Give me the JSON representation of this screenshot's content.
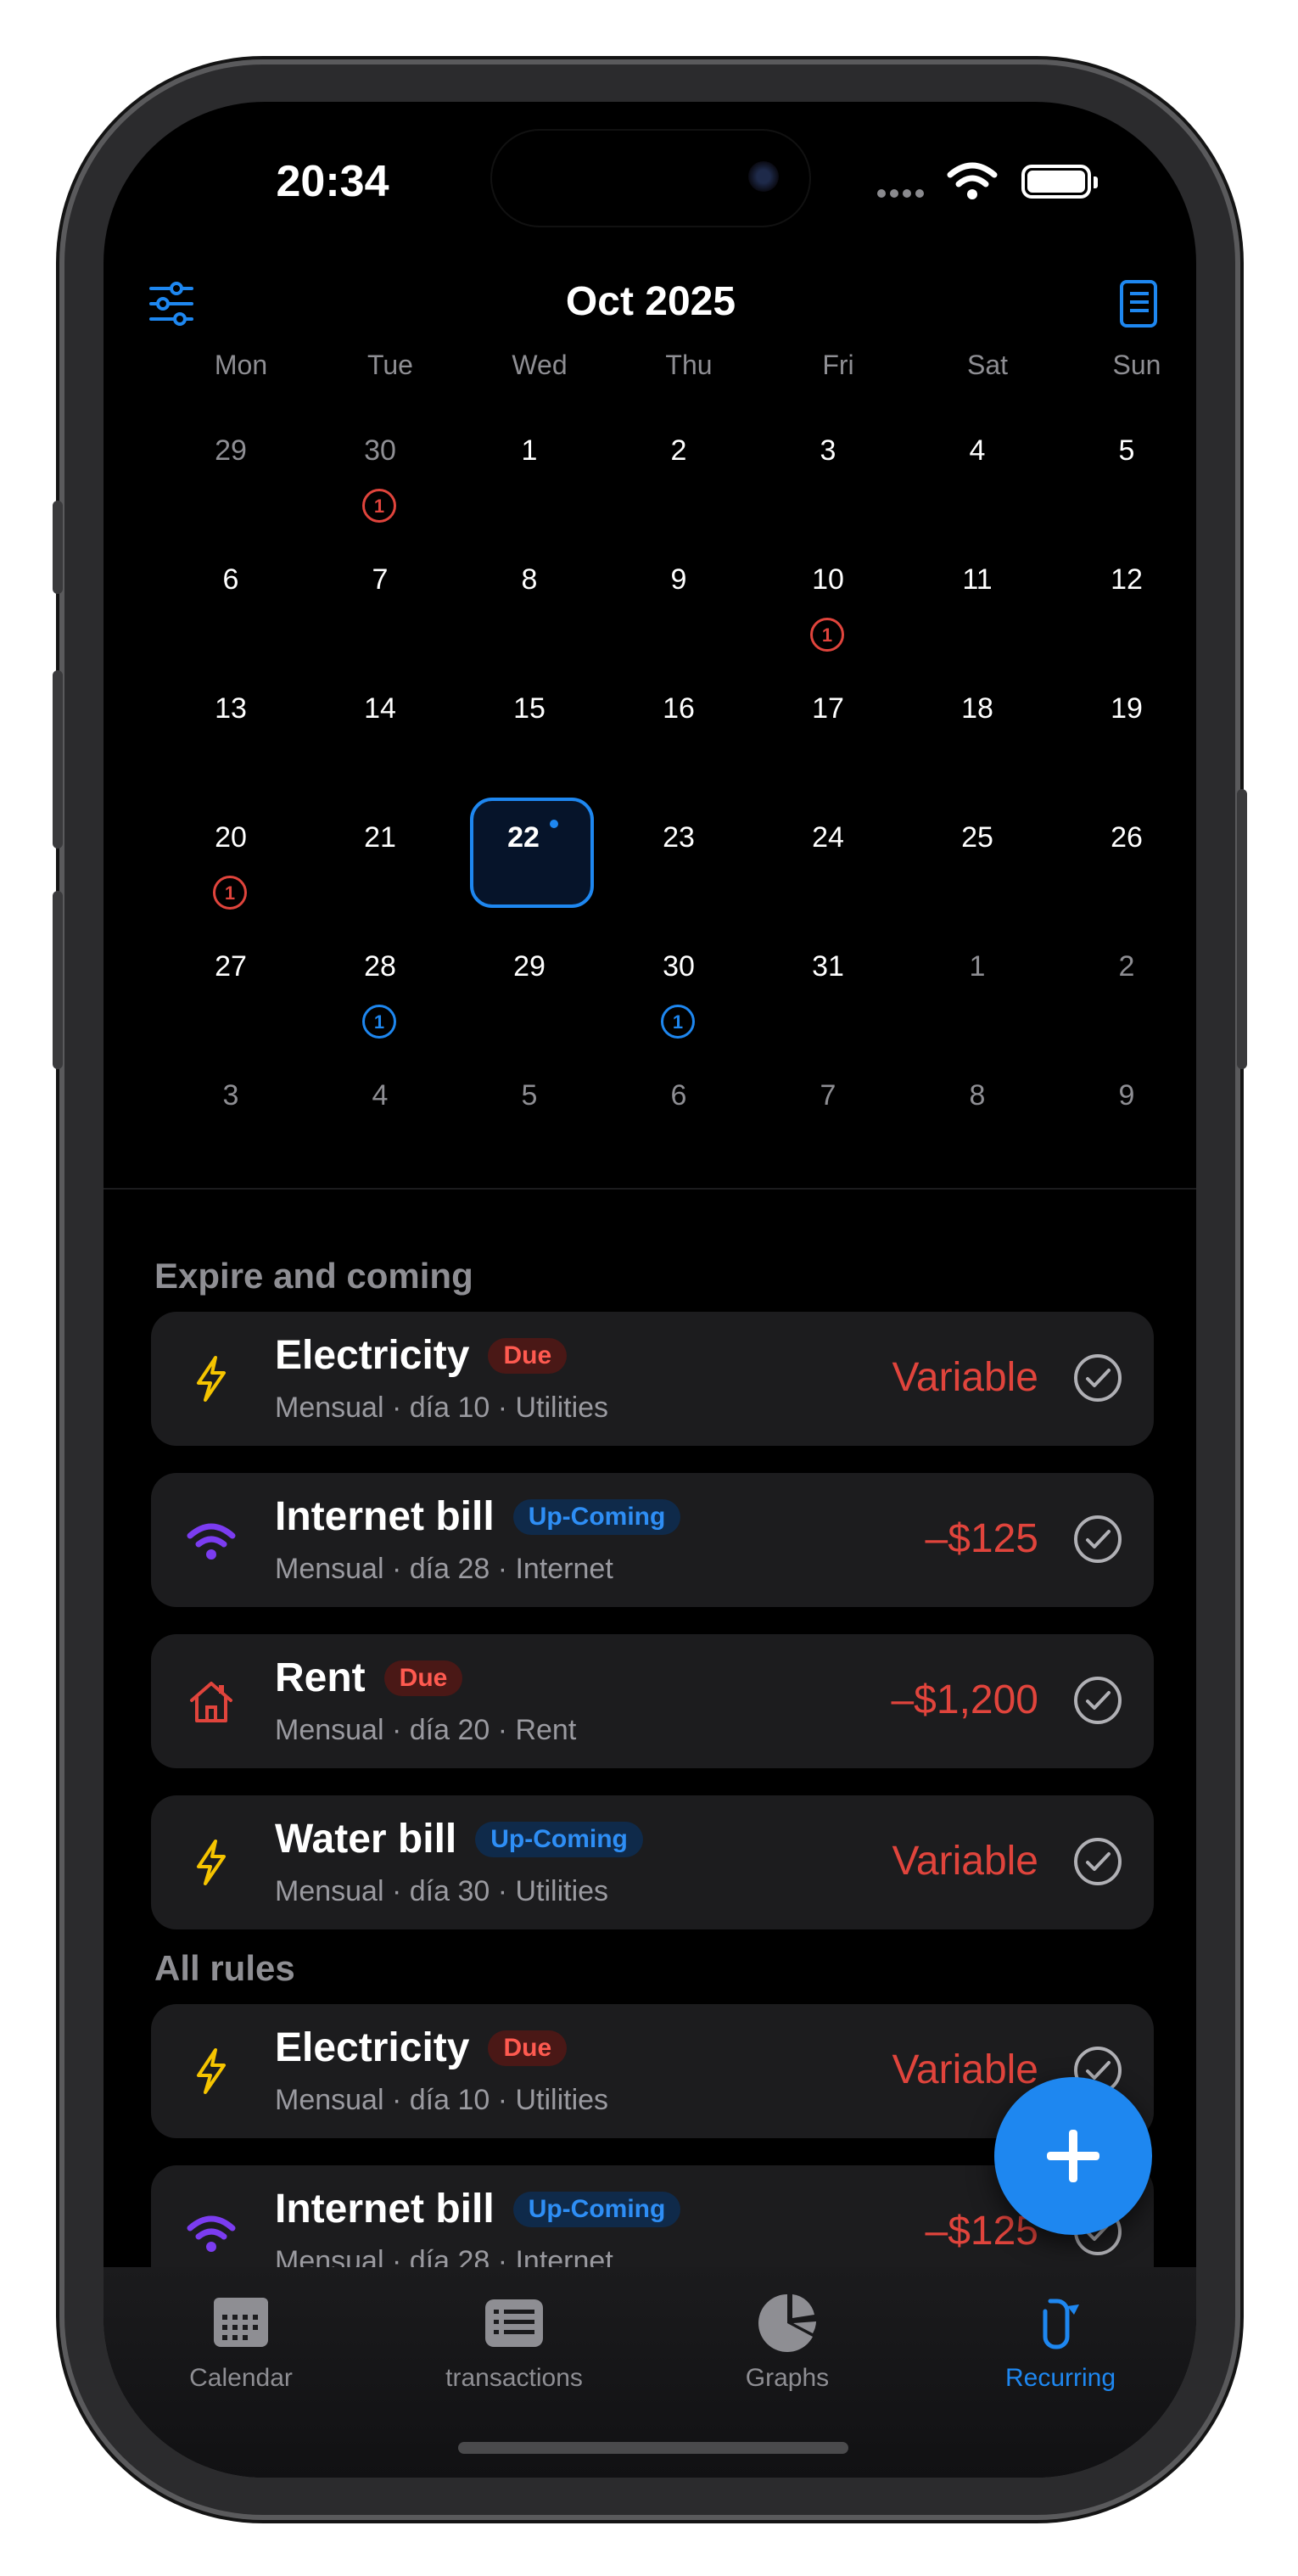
{
  "status": {
    "time": "20:34"
  },
  "header": {
    "title": "Oct 2025"
  },
  "calendar": {
    "weekdays": [
      "Mon",
      "Tue",
      "Wed",
      "Thu",
      "Fri",
      "Sat",
      "Sun"
    ],
    "weeks": [
      [
        "29",
        "30",
        "1",
        "2",
        "3",
        "4",
        "5"
      ],
      [
        "6",
        "7",
        "8",
        "9",
        "10",
        "11",
        "12"
      ],
      [
        "13",
        "14",
        "15",
        "16",
        "17",
        "18",
        "19"
      ],
      [
        "20",
        "21",
        "22",
        "23",
        "24",
        "25",
        "26"
      ],
      [
        "27",
        "28",
        "29",
        "30",
        "31",
        "1",
        "2"
      ],
      [
        "3",
        "4",
        "5",
        "6",
        "7",
        "8",
        "9"
      ]
    ],
    "today": "22",
    "badges": {
      "oct_30_prev": "1",
      "oct_10": "1",
      "oct_20": "1",
      "oct_28": "1",
      "oct_30": "1"
    }
  },
  "sections": {
    "expire_title": "Expire and coming",
    "all_title": "All rules"
  },
  "tags": {
    "due": "Due",
    "upcoming": "Up-Coming"
  },
  "expire_items": [
    {
      "name": "Electricity",
      "tag": "Due",
      "sub": "Mensual · día 10 · Utilities",
      "amount": "Variable",
      "icon": "bolt-icon"
    },
    {
      "name": "Internet bill",
      "tag": "Up-Coming",
      "sub": "Mensual · día 28 · Internet",
      "amount": "–$125",
      "icon": "wifi-icon"
    },
    {
      "name": "Rent",
      "tag": "Due",
      "sub": "Mensual · día 20 · Rent",
      "amount": "–$1,200",
      "icon": "house-icon"
    },
    {
      "name": "Water bill",
      "tag": "Up-Coming",
      "sub": "Mensual · día 30 · Utilities",
      "amount": "Variable",
      "icon": "bolt-icon"
    }
  ],
  "all_items": [
    {
      "name": "Electricity",
      "tag": "Due",
      "sub": "Mensual · día 10 · Utilities",
      "amount": "Variable",
      "icon": "bolt-icon"
    },
    {
      "name": "Internet bill",
      "tag": "Up-Coming",
      "sub": "Mensual · día 28 · Internet",
      "amount": "–$125",
      "icon": "wifi-icon"
    }
  ],
  "tabs": [
    {
      "label": "Calendar",
      "icon": "calendar-icon"
    },
    {
      "label": "transactions",
      "icon": "list-icon"
    },
    {
      "label": "Graphs",
      "icon": "pie-chart-icon"
    },
    {
      "label": "Recurring",
      "icon": "recurring-icon",
      "active": true
    }
  ],
  "colors": {
    "accent": "#1e87f0",
    "danger": "#e0443c",
    "due_tag_bg": "#4a1816",
    "upcoming_tag_bg": "#0f2a4a",
    "card_bg": "#1c1c1e"
  }
}
